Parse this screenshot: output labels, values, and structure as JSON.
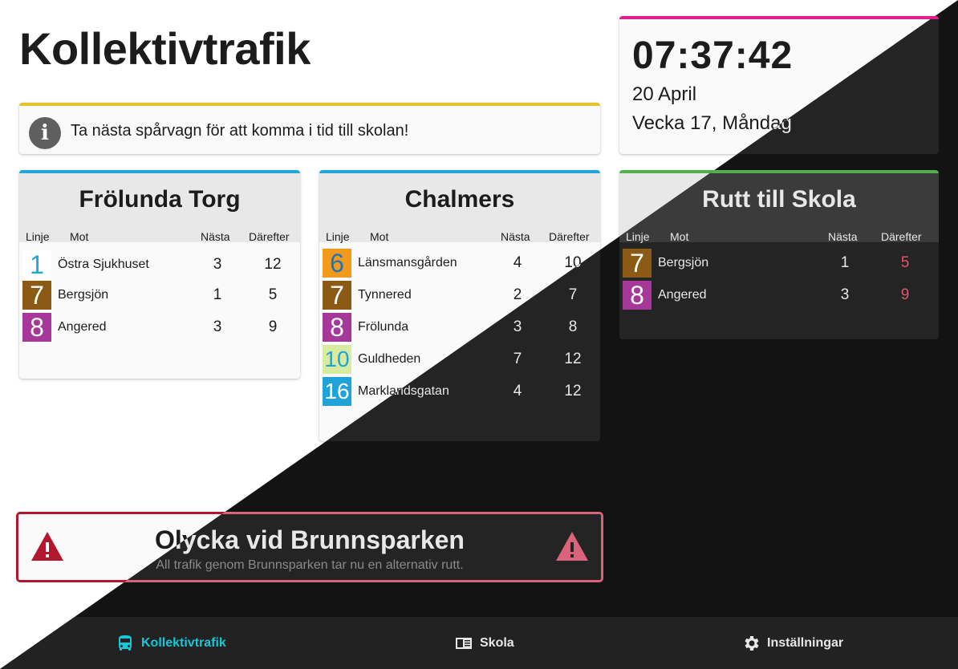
{
  "page_title": "Kollektivtrafik",
  "info": {
    "message": "Ta nästa spårvagn för att komma i tid till skolan!",
    "icon": "info-icon"
  },
  "clock": {
    "time": "07:37:42",
    "date": "20 April",
    "week": "Vecka 17, Måndag"
  },
  "columns": {
    "line": "Linje",
    "direction": "Mot",
    "next": "Nästa",
    "after": "Därefter"
  },
  "stops": [
    {
      "name": "Frölunda Torg",
      "rows": [
        {
          "line": "1",
          "color": "#ffffff",
          "text_color": "#20a6d9",
          "dest": "Östra Sjukhuset",
          "next": "3",
          "after": "12"
        },
        {
          "line": "7",
          "color": "#8b5a14",
          "text_color": "#ffffff",
          "dest": "Bergsjön",
          "next": "1",
          "after": "5"
        },
        {
          "line": "8",
          "color": "#a6389a",
          "text_color": "#ffffff",
          "dest": "Angered",
          "next": "3",
          "after": "9"
        }
      ]
    },
    {
      "name": "Chalmers",
      "rows": [
        {
          "line": "6",
          "color": "#f39a1c",
          "text_color": "#1f75b6",
          "dest": "Länsmansgården",
          "next": "4",
          "after": "10"
        },
        {
          "line": "7",
          "color": "#8b5a14",
          "text_color": "#ffffff",
          "dest": "Tynnered",
          "next": "2",
          "after": "7"
        },
        {
          "line": "8",
          "color": "#a6389a",
          "text_color": "#ffffff",
          "dest": "Frölunda",
          "next": "3",
          "after": "8"
        },
        {
          "line": "10",
          "color": "#d7eca0",
          "text_color": "#1fa3d8",
          "dest": "Guldheden",
          "next": "7",
          "after": "12"
        },
        {
          "line": "16",
          "color": "#1fa3d8",
          "text_color": "#ffffff",
          "dest": "Marklandsgatan",
          "next": "4",
          "after": "12"
        }
      ]
    }
  ],
  "route": {
    "name": "Rutt till Skola",
    "rows": [
      {
        "line": "7",
        "color": "#8b5a14",
        "text_color": "#ffffff",
        "dest": "Bergsjön",
        "next": "1",
        "after": "5"
      },
      {
        "line": "8",
        "color": "#a6389a",
        "text_color": "#ffffff",
        "dest": "Angered",
        "next": "3",
        "after": "9"
      }
    ]
  },
  "alert": {
    "title": "Olycka vid Brunnsparken",
    "subtitle": "All trafik genom Brunnsparken tar nu en alternativ rutt.",
    "icon": "warning-icon"
  },
  "nav": [
    {
      "label": "Kollektivtrafik",
      "icon": "bus-icon",
      "active": true
    },
    {
      "label": "Skola",
      "icon": "book-icon",
      "active": false
    },
    {
      "label": "Inställningar",
      "icon": "gear-icon",
      "active": false
    }
  ],
  "colors": {
    "accent": "#18c6d6",
    "info_bar": "#e6c32a",
    "clock_bar": "#e21f8f",
    "stop_bar": "#20a6d9",
    "route_bar": "#4fb04c",
    "alert_border": "#b3172e"
  }
}
